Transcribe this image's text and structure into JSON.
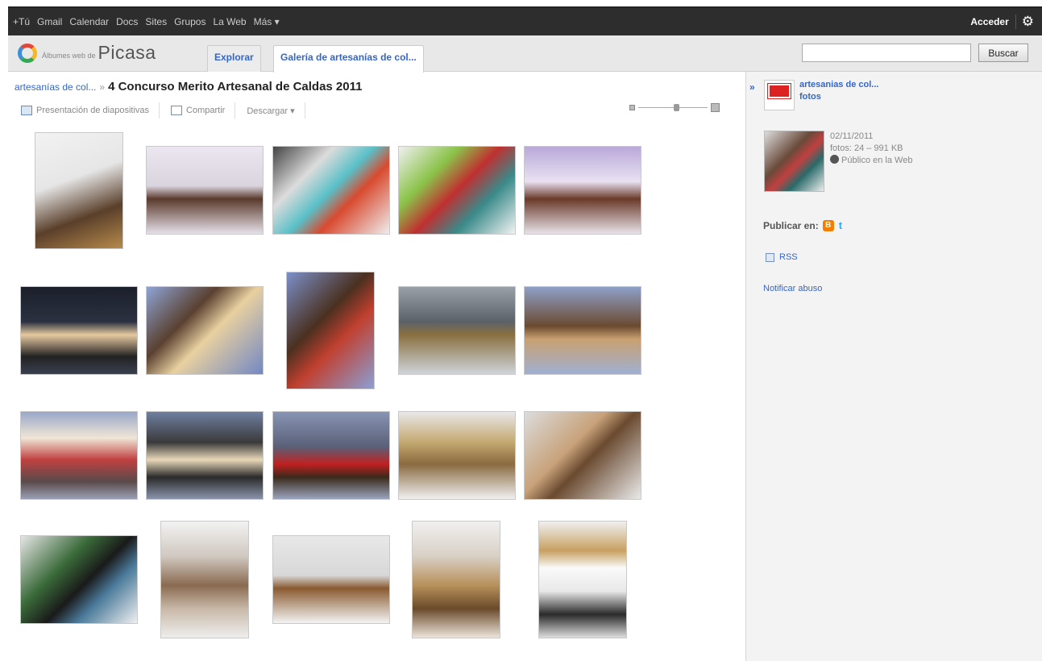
{
  "topbar": {
    "links": [
      "+Tú",
      "Gmail",
      "Calendar",
      "Docs",
      "Sites",
      "Grupos",
      "La Web",
      "Más ▾"
    ],
    "signin": "Acceder",
    "settings_icon": "gear-icon"
  },
  "header": {
    "logo_small": "Álbumes web de",
    "logo_big": "Picasa",
    "tab_explore": "Explorar",
    "tab_gallery": "Galería de artesanías de col...",
    "search_placeholder": "",
    "search_button": "Buscar"
  },
  "breadcrumb": {
    "parent": "artesanías de col...",
    "separator": "»",
    "title": "4 Concurso Merito Artesanal de Caldas 2011"
  },
  "toolbar": {
    "slideshow": "Presentación de diapositivas",
    "share": "Compartir",
    "download": "Descargar ▾"
  },
  "photos": [
    {
      "bg": "linear-gradient(160deg,#f2f2f2 0%,#e6e6e6 40%,#5a3f2a 70%,#b78a4b 100%)"
    },
    {
      "bg": "linear-gradient(180deg,#ebe6ef 0%,#d9d4de 45%,#5b3a2c 60%,#e6e0e8 100%)"
    },
    {
      "bg": "linear-gradient(135deg,#444 0%,#dcdcdc 30%,#5ac0c8 50%,#d84a2f 65%,#eee 100%)"
    },
    {
      "bg": "linear-gradient(135deg,#f0f0f0 0%,#8bc34a 30%,#c03030 50%,#3a8a8a 70%,#f3f3f3 100%)"
    },
    {
      "bg": "linear-gradient(180deg,#b9a8d9 0%,#e9e2f2 40%,#6a3a2a 60%,#e8e2e8 100%)"
    },
    {
      "bg": "linear-gradient(180deg,#1a1f2a 0%,#2b3140 40%,#e6c9a0 55%,#222 80%,#3a4050 100%)"
    },
    {
      "bg": "linear-gradient(135deg,#8fa4d6 0%,#5a4030 35%,#e8d0a0 55%,#7288c4 100%)"
    },
    {
      "bg": "linear-gradient(135deg,#7c90c9 0%,#4a3020 40%,#c04030 60%,#8aa0d6 100%)"
    },
    {
      "bg": "linear-gradient(180deg,#9aa0a8 0%,#5b6168 40%,#8a7040 55%,#cfd4da 100%)"
    },
    {
      "bg": "linear-gradient(180deg,#8ea0c8 0%,#6b4a30 45%,#c9a070 60%,#9fb0d2 100%)"
    },
    {
      "bg": "linear-gradient(180deg,#9aa7c8 0%,#f0e6d6 30%,#c04040 55%,#5a4a4a 80%,#9aa0b4 100%)"
    },
    {
      "bg": "linear-gradient(180deg,#6f7fa0 0%,#3a3a3a 35%,#e8d8b8 55%,#2a2a2a 75%,#8a94aa 100%)"
    },
    {
      "bg": "linear-gradient(180deg,#8894b4 0%,#5a6078 40%,#c02020 60%,#3a2a1a 75%,#9aa4be 100%)"
    },
    {
      "bg": "linear-gradient(180deg,#e8e8e8 0%,#c4a870 35%,#8a6a40 60%,#f0f0f0 100%)"
    },
    {
      "bg": "linear-gradient(135deg,#dcdcdc 0%,#c8a27a 40%,#6a4a30 55%,#eaeaea 100%)"
    },
    {
      "bg": "linear-gradient(135deg,#e6e6e6 0%,#3a6a3a 35%,#1a1a1a 55%,#4a7a9a 70%,#f0f0f0 100%)"
    },
    {
      "bg": "linear-gradient(180deg,#f2f2f2 0%,#d0c8c0 30%,#8a6a50 55%,#c8b8a8 75%,#eee 100%)"
    },
    {
      "bg": "linear-gradient(180deg,#e8e8e8 0%,#d8d8d8 45%,#8a5a30 60%,#f4f4f4 100%)"
    },
    {
      "bg": "linear-gradient(180deg,#f0f0f0 0%,#d8d0c4 30%,#b8905a 55%,#6a4a2a 75%,#ece4da 100%)"
    },
    {
      "bg": "linear-gradient(180deg,#f0f0f0 0%,#c8a060 25%,#fafafa 40%,#e8e8e8 60%,#2a2a2a 80%,#ddd 100%)"
    }
  ],
  "sidebar": {
    "owner_name": "artesanias de col...",
    "owner_photos": "fotos",
    "date": "02/11/2011",
    "stats": "fotos: 24 – 991 KB",
    "visibility": "Público en la Web",
    "publish_label": "Publicar en:",
    "rss": "RSS",
    "report": "Notificar abuso"
  }
}
